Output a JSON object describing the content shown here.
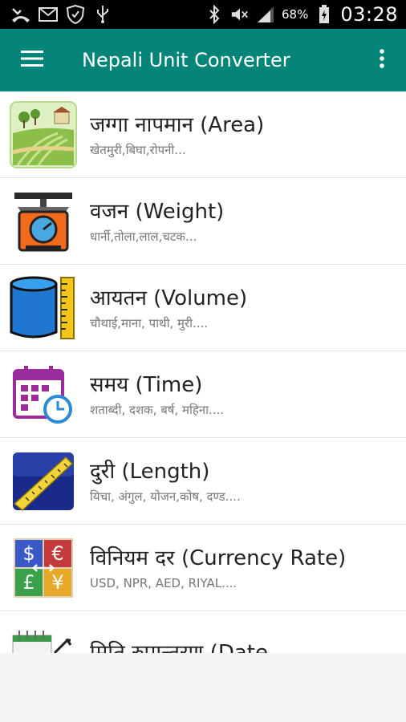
{
  "status_bar": {
    "battery": "68%",
    "time": "03:28",
    "left_icons": [
      "missed-call-icon",
      "mail-icon",
      "shield-icon",
      "usb-icon"
    ],
    "right_icons": [
      "bluetooth-icon",
      "mute-icon",
      "signal-icon",
      "battery-icon"
    ]
  },
  "app_bar": {
    "title": "Nepali Unit Converter",
    "background": "#058579"
  },
  "items": [
    {
      "title": "जग्गा नापमान (Area)",
      "subtitle": "खेतमुरी,बिघा,रोपनी...",
      "icon": "area-field-icon"
    },
    {
      "title": "वजन (Weight)",
      "subtitle": "धार्नी,तोला,लाल,चटक...",
      "icon": "weighing-scale-icon"
    },
    {
      "title": "आयतन (Volume)",
      "subtitle": "चौथाई,माना, पाथी, मुरी....",
      "icon": "cylinder-volume-icon"
    },
    {
      "title": "समय (Time)",
      "subtitle": "शताब्दी, दशक, बर्ष, महिना....",
      "icon": "calendar-clock-icon"
    },
    {
      "title": "दुरी (Length)",
      "subtitle": "यिचा, अंगुल, योजन,कोष, दण्ड....",
      "icon": "measuring-tape-icon"
    },
    {
      "title": "विनियम दर (Currency Rate)",
      "subtitle": "USD, NPR, AED, RIYAL....",
      "icon": "currency-exchange-icon"
    },
    {
      "title": "मिति रुपान्तरण (Date",
      "subtitle": "",
      "icon": "date-conversion-icon"
    }
  ]
}
